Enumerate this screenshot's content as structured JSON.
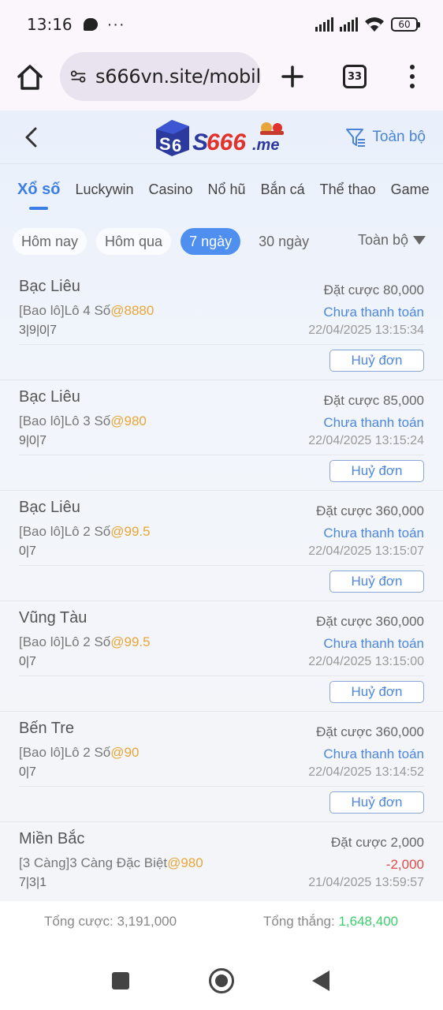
{
  "status_bar": {
    "time": "13:16",
    "dots": "···",
    "battery": "60"
  },
  "browser": {
    "url": "s666vn.site/mobil",
    "tab_count": "33"
  },
  "header": {
    "filter_label": "Toàn bộ"
  },
  "categories": [
    "Xổ số",
    "Luckywin",
    "Casino",
    "Nổ hũ",
    "Bắn cá",
    "Thể thao",
    "Game"
  ],
  "date_filters": [
    "Hôm nay",
    "Hôm qua",
    "7 ngày",
    "30 ngày"
  ],
  "date_filter_active": "7 ngày",
  "date_scope": "Toàn bộ",
  "bets": [
    {
      "name": "Bạc Liêu",
      "type": "[Bao lô]Lô 4 Số",
      "odds": "@8880",
      "numbers": "3|9|0|7",
      "stake": "Đặt cược 80,000",
      "status": "Chưa thanh toán",
      "time": "22/04/2025 13:15:34",
      "cancel": "Huỷ đơn"
    },
    {
      "name": "Bạc Liêu",
      "type": "[Bao lô]Lô 3 Số",
      "odds": "@980",
      "numbers": "9|0|7",
      "stake": "Đặt cược 85,000",
      "status": "Chưa thanh toán",
      "time": "22/04/2025 13:15:24",
      "cancel": "Huỷ đơn"
    },
    {
      "name": "Bạc Liêu",
      "type": "[Bao lô]Lô 2 Số",
      "odds": "@99.5",
      "numbers": "0|7",
      "stake": "Đặt cược 360,000",
      "status": "Chưa thanh toán",
      "time": "22/04/2025 13:15:07",
      "cancel": "Huỷ đơn"
    },
    {
      "name": "Vũng Tàu",
      "type": "[Bao lô]Lô 2 Số",
      "odds": "@99.5",
      "numbers": "0|7",
      "stake": "Đặt cược 360,000",
      "status": "Chưa thanh toán",
      "time": "22/04/2025 13:15:00",
      "cancel": "Huỷ đơn"
    },
    {
      "name": "Bến Tre",
      "type": "[Bao lô]Lô 2 Số",
      "odds": "@90",
      "numbers": "0|7",
      "stake": "Đặt cược 360,000",
      "status": "Chưa thanh toán",
      "time": "22/04/2025 13:14:52",
      "cancel": "Huỷ đơn"
    },
    {
      "name": "Miền Bắc",
      "type": "[3 Càng]3 Càng Đặc Biệt",
      "odds": "@980",
      "numbers": "7|3|1",
      "stake": "Đặt cược 2,000",
      "status": "-2,000",
      "time": "21/04/2025 13:59:57",
      "cancel": ""
    }
  ],
  "totals": {
    "bet_label": "Tổng cược: 3,191,000",
    "win_label": "Tổng thắng: ",
    "win_amount": "1,648,400"
  },
  "colors": {
    "accent": "#3c7fe4",
    "odds": "#e8a63a",
    "win": "#3bcf6b",
    "loss": "#e24a4a"
  }
}
